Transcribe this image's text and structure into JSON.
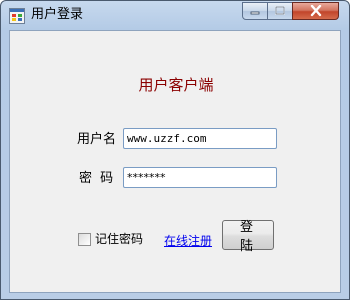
{
  "window": {
    "title": "用户登录",
    "controls": {
      "minimize": "minimize-icon",
      "maximize": "maximize-icon",
      "close": "close-icon"
    }
  },
  "form": {
    "heading": "用户客户端",
    "username_label": "用户名",
    "username_value": "www.uzzf.com",
    "password_label": "密 码",
    "password_value": "*******",
    "remember_label": "记住密码",
    "remember_checked": false,
    "register_link": "在线注册",
    "login_button": "登 陆"
  },
  "colors": {
    "heading": "#8b0000",
    "link": "#0000ee",
    "client_bg": "#f0f0f0",
    "close_button": "#c2452b"
  }
}
